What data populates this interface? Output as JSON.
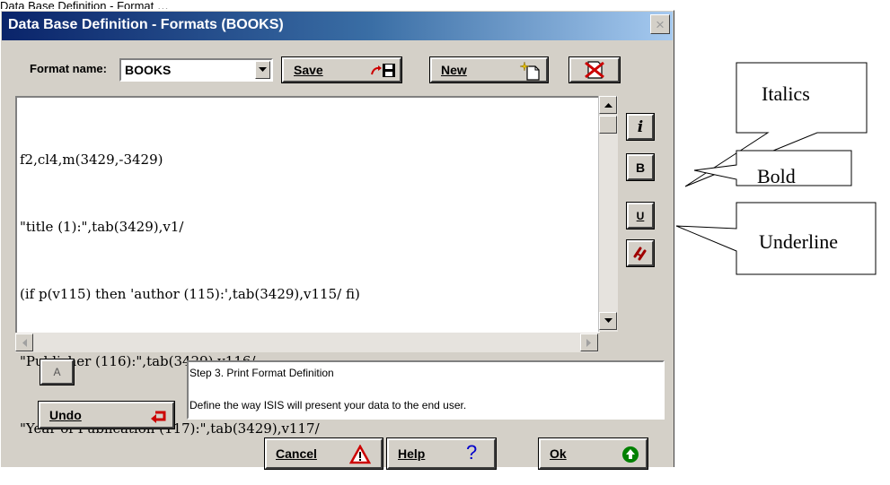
{
  "top_partial_text": "Data Base Definition - Format …",
  "window": {
    "title": "Data Base Definition - Formats (BOOKS)",
    "close_glyph": "×"
  },
  "format": {
    "label": "Format name:",
    "value": "BOOKS"
  },
  "toolbar": {
    "save_label": "Save",
    "new_label": "New"
  },
  "editor": {
    "lines": [
      "f2,cl4,m(3429,-3429)",
      "\"title (1):\",tab(3429),v1/",
      "(if p(v115) then 'author (115):',tab(3429),v115/ fi)",
      "\"Publisher (116):\",tab(3429),v116/",
      "\"Year of Publication (117):\",tab(3429),v117/"
    ]
  },
  "side_buttons": {
    "italic": "i",
    "bold": "B",
    "underline": "U"
  },
  "font_button_glyph": "A",
  "undo_label": "Undo",
  "step": {
    "title": "Step 3. Print Format Definition",
    "description": "Define the way ISIS will present your data to the end user."
  },
  "bottom": {
    "cancel_label": "Cancel",
    "help_label": "Help",
    "ok_label": "Ok"
  },
  "callouts": {
    "italics": "Italics",
    "bold": "Bold",
    "underline": "Underline"
  },
  "colors": {
    "title_start": "#0a246a",
    "title_end": "#a6caf0",
    "undo_arrow": "#cc0000",
    "ok_icon": "#008000",
    "cancel_icon": "#cc0000"
  }
}
